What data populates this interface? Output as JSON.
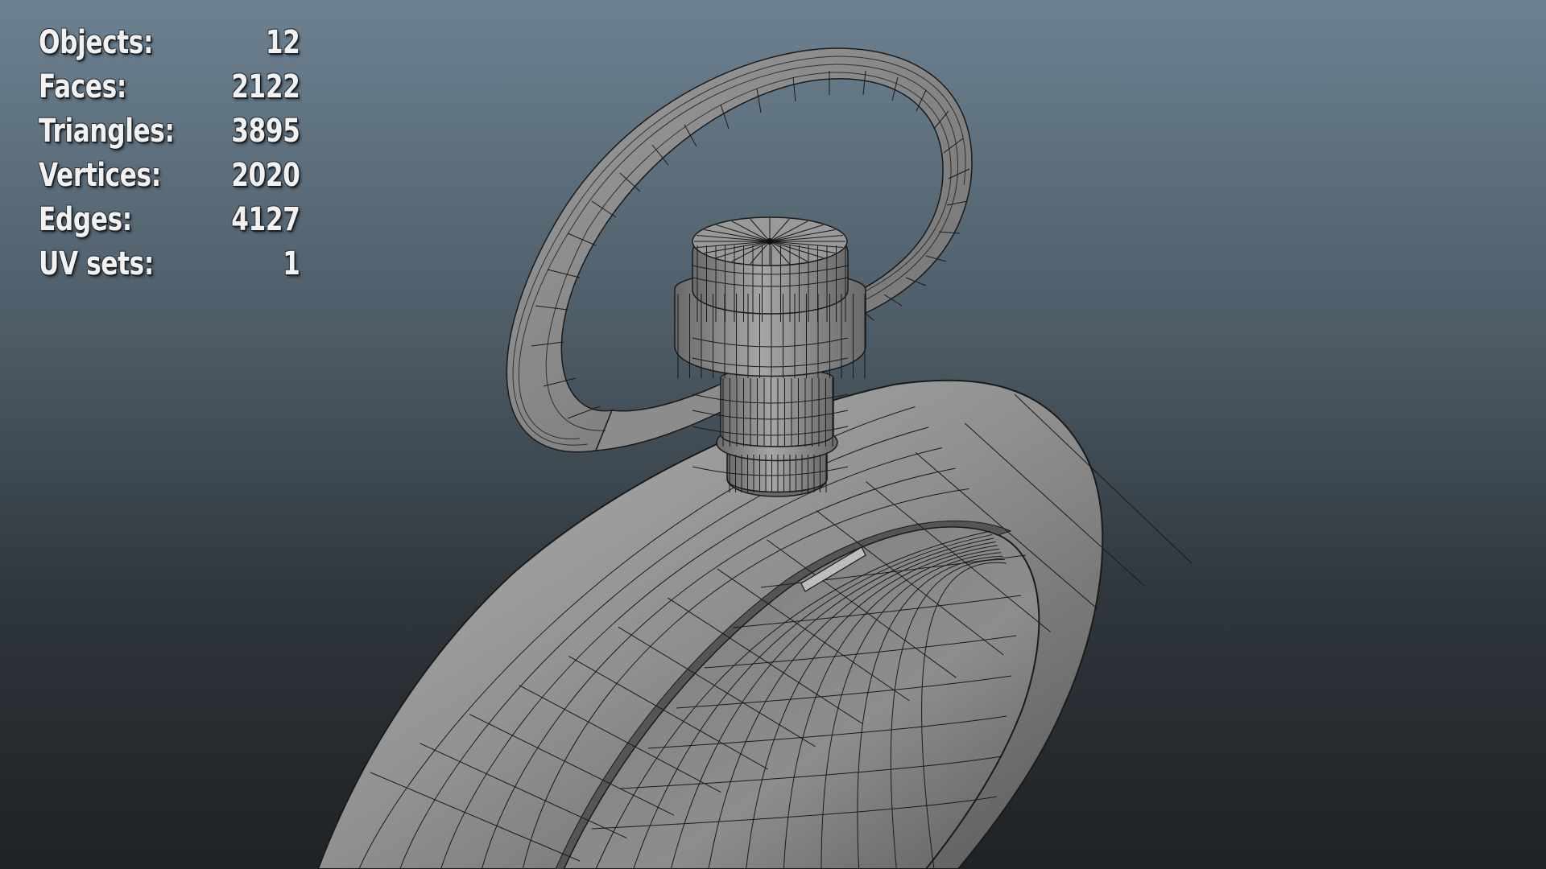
{
  "viewport": {
    "background_top": "#6c8191",
    "background_bottom": "#1f2225",
    "mesh_color": "#9a9a9a",
    "wire_color": "#1a1a1a"
  },
  "hud": {
    "rows": [
      {
        "label": "Objects:",
        "value": "12"
      },
      {
        "label": "Faces:",
        "value": "2122"
      },
      {
        "label": "Triangles:",
        "value": "3895"
      },
      {
        "label": "Vertices:",
        "value": "2020"
      },
      {
        "label": "Edges:",
        "value": "4127"
      },
      {
        "label": "UV sets:",
        "value": "1"
      }
    ]
  }
}
